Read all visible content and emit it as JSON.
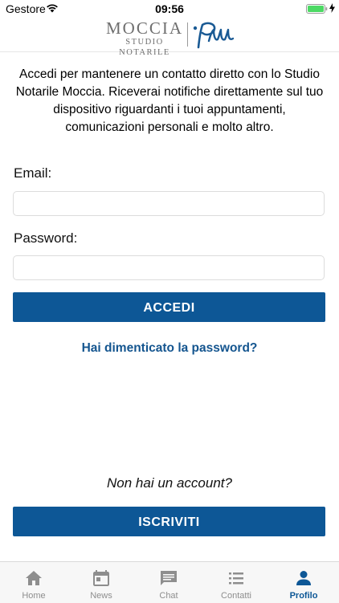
{
  "status_bar": {
    "carrier": "Gestore",
    "time": "09:56"
  },
  "header": {
    "logo_name": "MOCCIA",
    "logo_subtitle": "STUDIO NOTARILE"
  },
  "intro_text": "Accedi per mantenere un contatto diretto con lo Studio Notarile Moccia. Riceverai notifiche direttamente sul tuo dispositivo riguardanti i tuoi appuntamenti, comunicazioni personali e molto altro.",
  "form": {
    "email_label": "Email:",
    "email_value": "",
    "password_label": "Password:",
    "password_value": "",
    "login_button": "ACCEDI",
    "forgot_link": "Hai dimenticato la password?"
  },
  "signup": {
    "prompt": "Non hai un account?",
    "button": "ISCRIVITI"
  },
  "tabs": [
    {
      "label": "Home",
      "icon": "home-icon",
      "active": false
    },
    {
      "label": "News",
      "icon": "calendar-icon",
      "active": false
    },
    {
      "label": "Chat",
      "icon": "chat-icon",
      "active": false
    },
    {
      "label": "Contatti",
      "icon": "list-icon",
      "active": false
    },
    {
      "label": "Profilo",
      "icon": "person-icon",
      "active": true
    }
  ],
  "colors": {
    "accent": "#0d5796",
    "inactive": "#8e8e8e",
    "battery": "#4cd964"
  }
}
